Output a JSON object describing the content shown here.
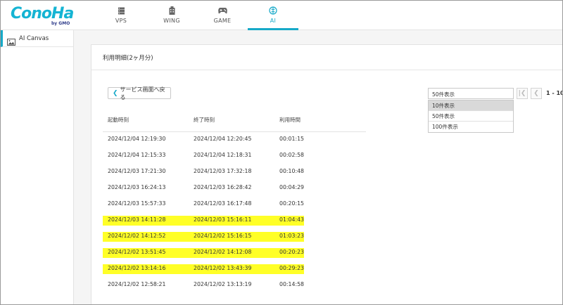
{
  "brand": {
    "logo_text": "ConoHa",
    "logo_sub": "by GMO"
  },
  "nav": {
    "items": [
      {
        "label": "VPS",
        "icon": "server-icon",
        "active": false
      },
      {
        "label": "WING",
        "icon": "building-icon",
        "active": false
      },
      {
        "label": "GAME",
        "icon": "gamepad-icon",
        "active": false
      },
      {
        "label": "AI",
        "icon": "ai-brain-icon",
        "active": true
      }
    ],
    "accent": "#16a9c8"
  },
  "sidebar": {
    "items": [
      {
        "label": "AI Canvas",
        "icon": "image-icon",
        "active": true
      }
    ]
  },
  "main": {
    "card_title": "利用明細(2ヶ月分)",
    "back_label": "サービス画面へ戻る",
    "table": {
      "headers": [
        "起動時刻",
        "終了時刻",
        "利用時間"
      ],
      "rows": [
        {
          "start": "2024/12/04 12:19:30",
          "end": "2024/12/04 12:20:45",
          "duration": "00:01:15",
          "highlight": false
        },
        {
          "start": "2024/12/04 12:15:33",
          "end": "2024/12/04 12:18:31",
          "duration": "00:02:58",
          "highlight": false
        },
        {
          "start": "2024/12/03 17:21:30",
          "end": "2024/12/03 17:32:18",
          "duration": "00:10:48",
          "highlight": false
        },
        {
          "start": "2024/12/03 16:24:13",
          "end": "2024/12/03 16:28:42",
          "duration": "00:04:29",
          "highlight": false
        },
        {
          "start": "2024/12/03 15:57:33",
          "end": "2024/12/03 16:17:48",
          "duration": "00:20:15",
          "highlight": false
        },
        {
          "start": "2024/12/03 14:11:28",
          "end": "2024/12/03 15:16:11",
          "duration": "01:04:43",
          "highlight": true
        },
        {
          "start": "2024/12/02 14:12:52",
          "end": "2024/12/02 15:16:15",
          "duration": "01:03:23",
          "highlight": true
        },
        {
          "start": "2024/12/02 13:51:45",
          "end": "2024/12/02 14:12:08",
          "duration": "00:20:23",
          "highlight": true
        },
        {
          "start": "2024/12/02 13:14:16",
          "end": "2024/12/02 13:43:39",
          "duration": "00:29:23",
          "highlight": true
        },
        {
          "start": "2024/12/02 12:58:21",
          "end": "2024/12/02 13:13:19",
          "duration": "00:14:58",
          "highlight": false
        }
      ],
      "highlight_color": "#ffff27"
    },
    "per_page": {
      "selected": "50件表示",
      "options": [
        "10件表示",
        "50件表示",
        "100件表示"
      ],
      "hovered": "10件表示"
    },
    "pagination": {
      "first_icon": "first-page-icon",
      "prev_icon": "prev-page-icon",
      "range_text": "1 - 10"
    }
  }
}
